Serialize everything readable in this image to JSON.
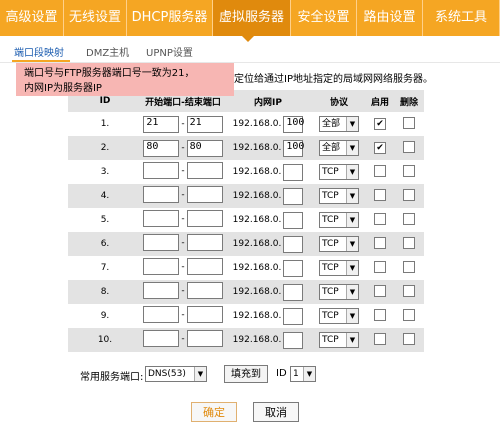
{
  "nav": {
    "items": [
      {
        "label": "高级设置",
        "w": 64
      },
      {
        "label": "无线设置",
        "w": 63
      },
      {
        "label": "DHCP服务器",
        "w": 86
      },
      {
        "label": "虚拟服务器",
        "w": 78
      },
      {
        "label": "安全设置",
        "w": 66
      },
      {
        "label": "路由设置",
        "w": 66
      },
      {
        "label": "系统工具",
        "w": 77
      }
    ],
    "active_index": 3
  },
  "subtabs": [
    "端口段映射",
    "DMZ主机",
    "UPNP设置"
  ],
  "tooltip": {
    "line1": "端口号与FTP服务器端口号一致为21，",
    "line2": "内网IP为服务器IP"
  },
  "description": "定位给通过IP地址指定的局域网网络服务器。",
  "table": {
    "headers": {
      "id": "ID",
      "ports": "开始端口-结束端口",
      "ip": "内网IP",
      "proto": "协议",
      "enable": "启用",
      "delete": "删除"
    },
    "ip_prefix": "192.168.0.",
    "rows": [
      {
        "id": "1.",
        "start": "21",
        "end": "21",
        "ip": "100",
        "proto": "全部",
        "enabled": "✔",
        "deleted": ""
      },
      {
        "id": "2.",
        "start": "80",
        "end": "80",
        "ip": "100",
        "proto": "全部",
        "enabled": "✔",
        "deleted": ""
      },
      {
        "id": "3.",
        "start": "",
        "end": "",
        "ip": "",
        "proto": "TCP",
        "enabled": "",
        "deleted": ""
      },
      {
        "id": "4.",
        "start": "",
        "end": "",
        "ip": "",
        "proto": "TCP",
        "enabled": "",
        "deleted": ""
      },
      {
        "id": "5.",
        "start": "",
        "end": "",
        "ip": "",
        "proto": "TCP",
        "enabled": "",
        "deleted": ""
      },
      {
        "id": "6.",
        "start": "",
        "end": "",
        "ip": "",
        "proto": "TCP",
        "enabled": "",
        "deleted": ""
      },
      {
        "id": "7.",
        "start": "",
        "end": "",
        "ip": "",
        "proto": "TCP",
        "enabled": "",
        "deleted": ""
      },
      {
        "id": "8.",
        "start": "",
        "end": "",
        "ip": "",
        "proto": "TCP",
        "enabled": "",
        "deleted": ""
      },
      {
        "id": "9.",
        "start": "",
        "end": "",
        "ip": "",
        "proto": "TCP",
        "enabled": "",
        "deleted": ""
      },
      {
        "id": "10.",
        "start": "",
        "end": "",
        "ip": "",
        "proto": "TCP",
        "enabled": "",
        "deleted": ""
      }
    ]
  },
  "common": {
    "label": "常用服务端口:",
    "service": "DNS(53)",
    "fill_button": "填充到",
    "id_label": "ID",
    "id_value": "1"
  },
  "buttons": {
    "ok": "确定",
    "cancel": "取消"
  },
  "colors": {
    "nav_bg": "#f5a623",
    "nav_active": "#e08a0d",
    "tooltip_bg": "#f7b6b3",
    "row_alt": "#e3e3e3"
  },
  "icons": {
    "dropdown": "triangle-down-icon",
    "check": "checkmark-icon"
  }
}
